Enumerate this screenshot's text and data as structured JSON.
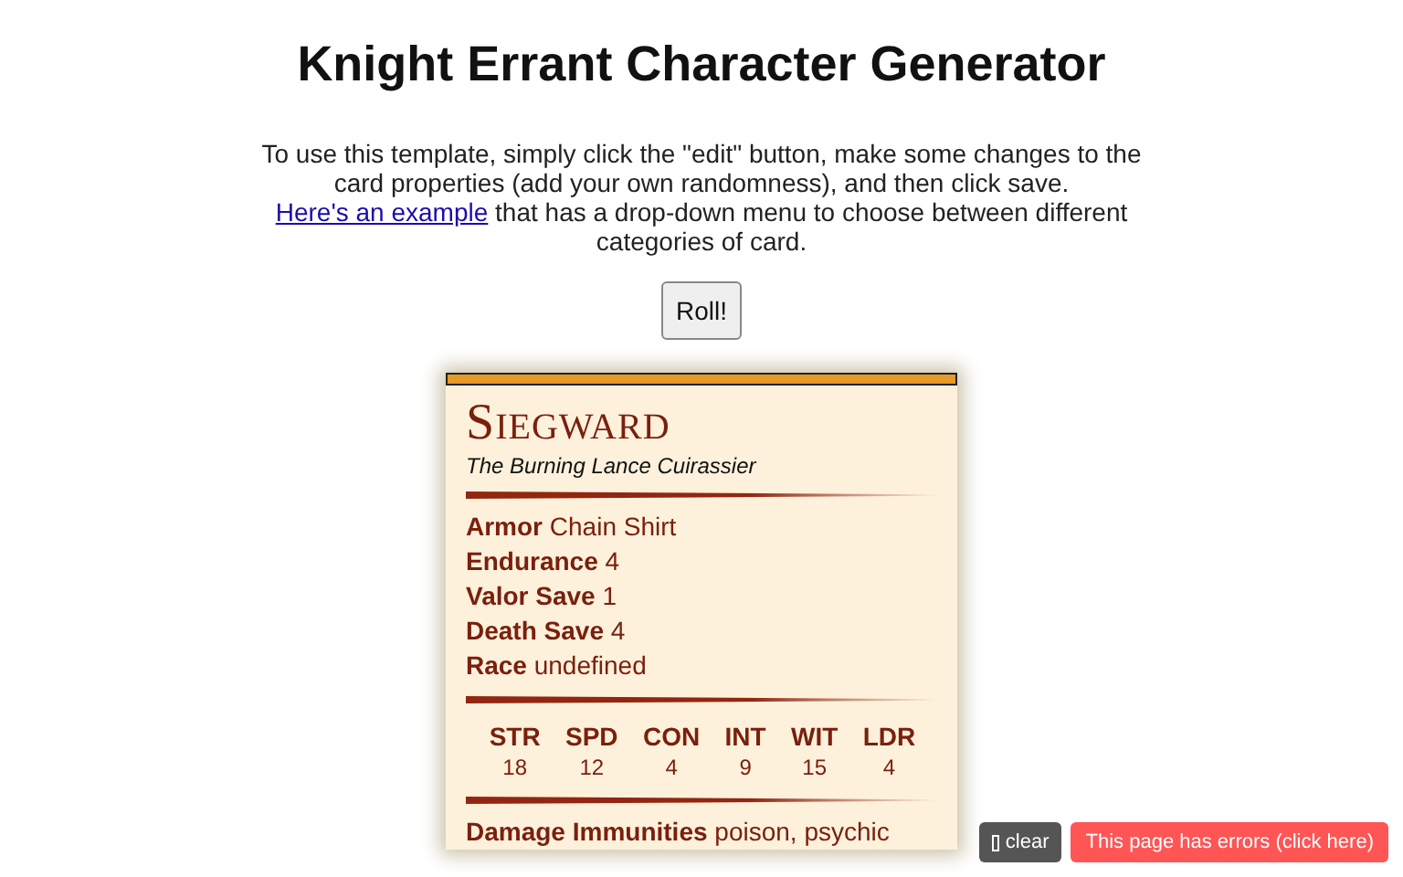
{
  "title": "Knight Errant Character Generator",
  "intro": {
    "before": "To use this template, simply click the \"edit\" button, make some changes to the card properties (add your own randomness), and then click save.",
    "link": "Here's an example",
    "after": "that has a drop-down menu to choose between different categories of card."
  },
  "roll_button": "Roll!",
  "card": {
    "name": "Siegward",
    "subtitle": "The Burning Lance Cuirassier",
    "properties": [
      {
        "label": "Armor",
        "value": "Chain Shirt"
      },
      {
        "label": "Endurance",
        "value": "4"
      },
      {
        "label": "Valor Save",
        "value": "1"
      },
      {
        "label": "Death Save",
        "value": "4"
      },
      {
        "label": "Race",
        "value": "undefined"
      }
    ],
    "abilities": [
      {
        "label": "STR",
        "value": "18"
      },
      {
        "label": "SPD",
        "value": "12"
      },
      {
        "label": "CON",
        "value": "4"
      },
      {
        "label": "INT",
        "value": "9"
      },
      {
        "label": "WIT",
        "value": "15"
      },
      {
        "label": "LDR",
        "value": "4"
      }
    ],
    "extra": {
      "label": "Damage Immunities",
      "value": "poison, psychic"
    }
  },
  "overlay": {
    "clear": "clear",
    "errors": "This page has errors (click here)"
  }
}
